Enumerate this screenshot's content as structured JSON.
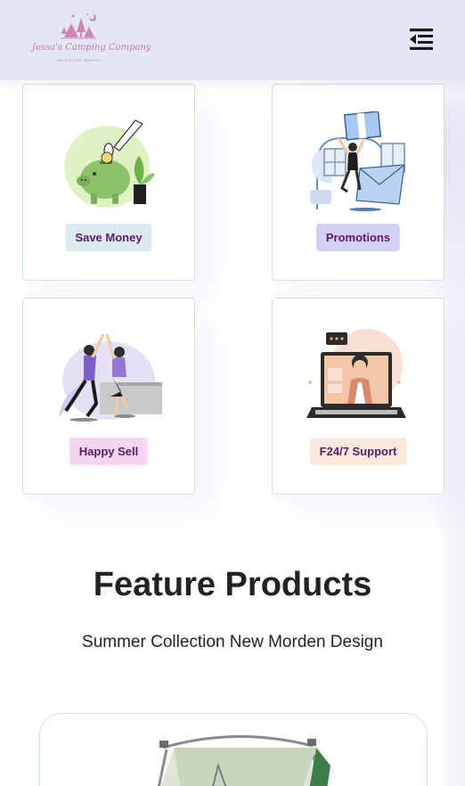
{
  "header": {
    "logo_name": "Jessa's Camping Company",
    "logo_tagline": "ADVENTURE AWAITS",
    "menu_icon": "menu-toggle-icon"
  },
  "features": [
    {
      "label": "Save Money",
      "icon": "piggy-bank-illustration",
      "badge_color": "#dbe9f0"
    },
    {
      "label": "Promotions",
      "icon": "promotion-illustration",
      "badge_color": "#d2d1f5"
    },
    {
      "label": "Happy Sell",
      "icon": "high-five-illustration",
      "badge_color": "#f4d6f0"
    },
    {
      "label": "F24/7 Support",
      "icon": "support-laptop-illustration",
      "badge_color": "#fbe9de"
    }
  ],
  "section": {
    "title": "Feature Products",
    "subtitle": "Summer Collection New Morden Design"
  },
  "products": [
    {
      "image": "tent-product-image"
    }
  ],
  "colors": {
    "header_bg": "#e3e6f3",
    "card_border": "#cce7d0",
    "badge_text": "#5b1a6e"
  }
}
